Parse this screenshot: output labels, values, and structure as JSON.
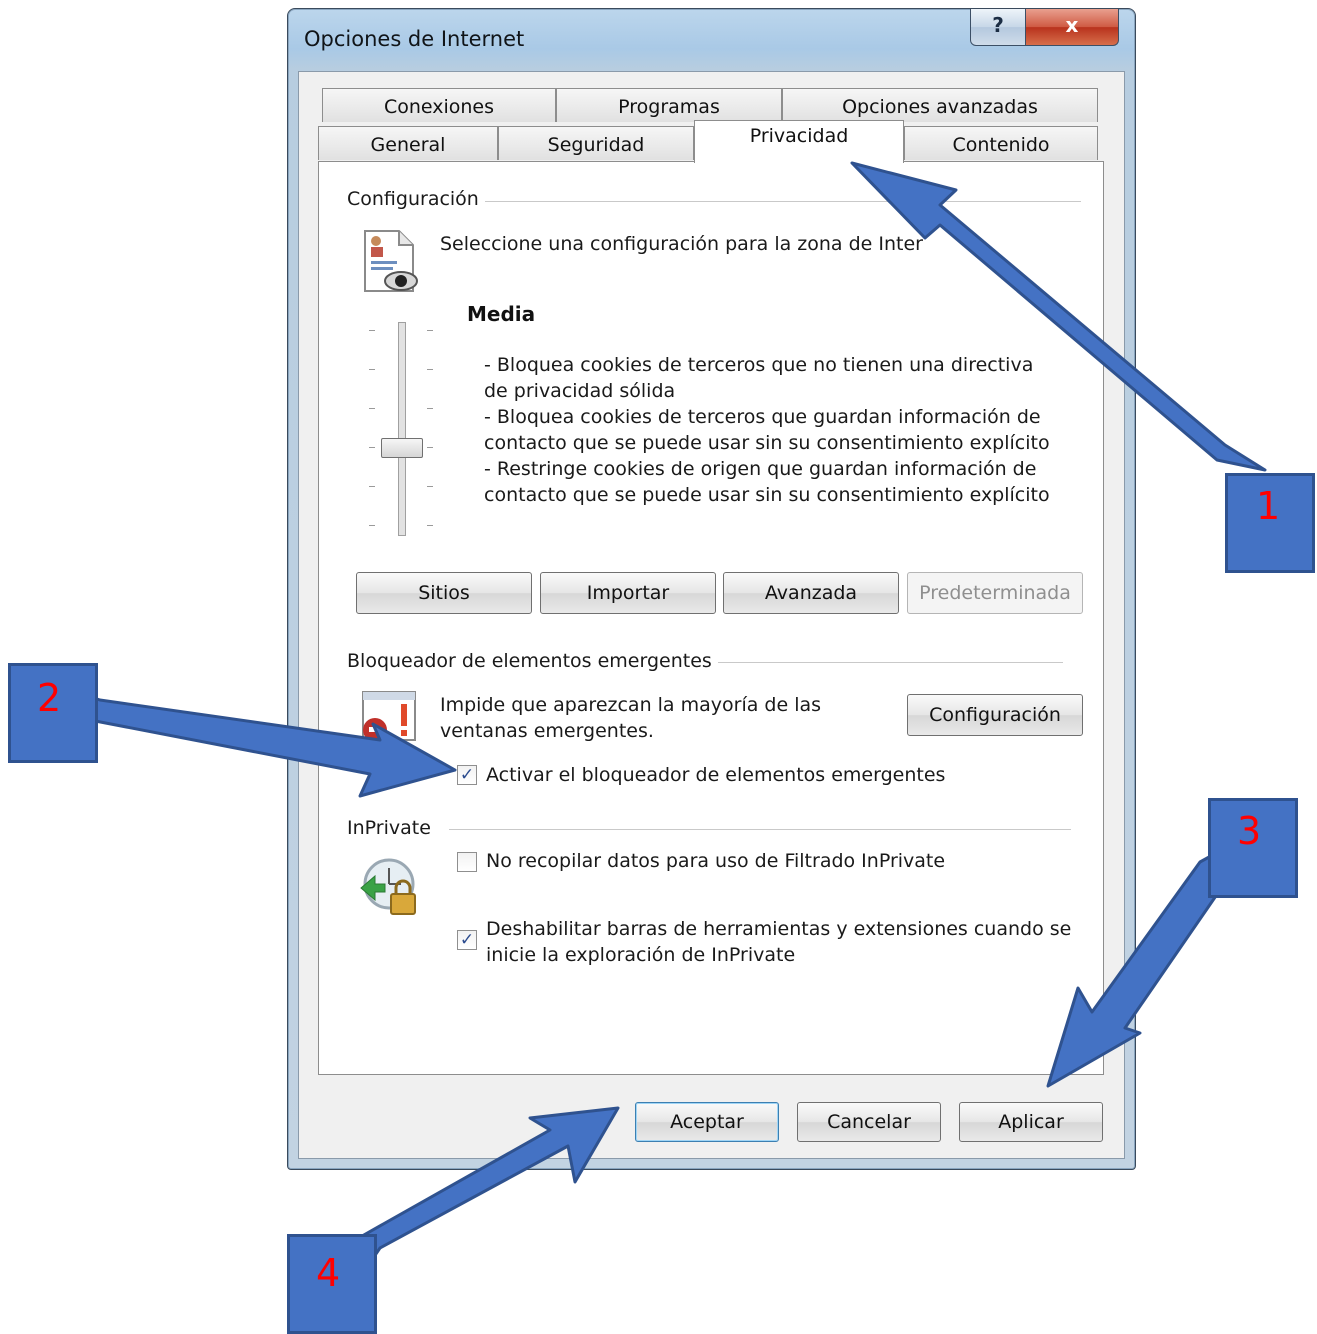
{
  "window": {
    "title": "Opciones de Internet",
    "help_glyph": "?",
    "close_glyph": "x"
  },
  "tabs_row1": [
    "Conexiones",
    "Programas",
    "Opciones avanzadas"
  ],
  "tabs_row2": [
    "General",
    "Seguridad",
    "Privacidad",
    "Contenido"
  ],
  "active_tab": "Privacidad",
  "config": {
    "heading": "Configuración",
    "intro": "Seleccione una configuración para la zona de Inter",
    "level_name": "Media",
    "description": [
      "- Bloquea cookies de terceros que no tienen una directiva",
      "de privacidad sólida",
      "- Bloquea cookies de terceros que guardan información de",
      "contacto que se puede usar sin su consentimiento explícito",
      "- Restringe cookies de origen que guardan información de",
      "contacto que se  puede usar sin su consentimiento explícito"
    ],
    "slider_level": 0.4,
    "buttons": {
      "sites": "Sitios",
      "import": "Importar",
      "advanced": "Avanzada",
      "default": "Predeterminada"
    }
  },
  "popup": {
    "heading": "Bloqueador de elementos emergentes",
    "description_line1": "Impide que aparezcan la mayoría de las",
    "description_line2": "ventanas emergentes.",
    "settings_button": "Configuración",
    "enable_label": "Activar el bloqueador de elementos emergentes",
    "enable_checked": true
  },
  "inprivate": {
    "heading": "InPrivate",
    "no_collect_label": "No recopilar datos para uso de Filtrado InPrivate",
    "no_collect_checked": false,
    "disable_toolbars_line1": "Deshabilitar barras de herramientas y extensiones cuando se",
    "disable_toolbars_line2": "inicie la exploración de InPrivate",
    "disable_toolbars_checked": true
  },
  "footer": {
    "ok": "Aceptar",
    "cancel": "Cancelar",
    "apply": "Aplicar"
  },
  "callouts": [
    "1",
    "2",
    "3",
    "4"
  ],
  "check_glyph": "✓",
  "colors": {
    "callout_fill": "#4472c4",
    "callout_text": "#ff0000",
    "arrow_fill": "#4472c4",
    "arrow_stroke": "#2f528f"
  }
}
